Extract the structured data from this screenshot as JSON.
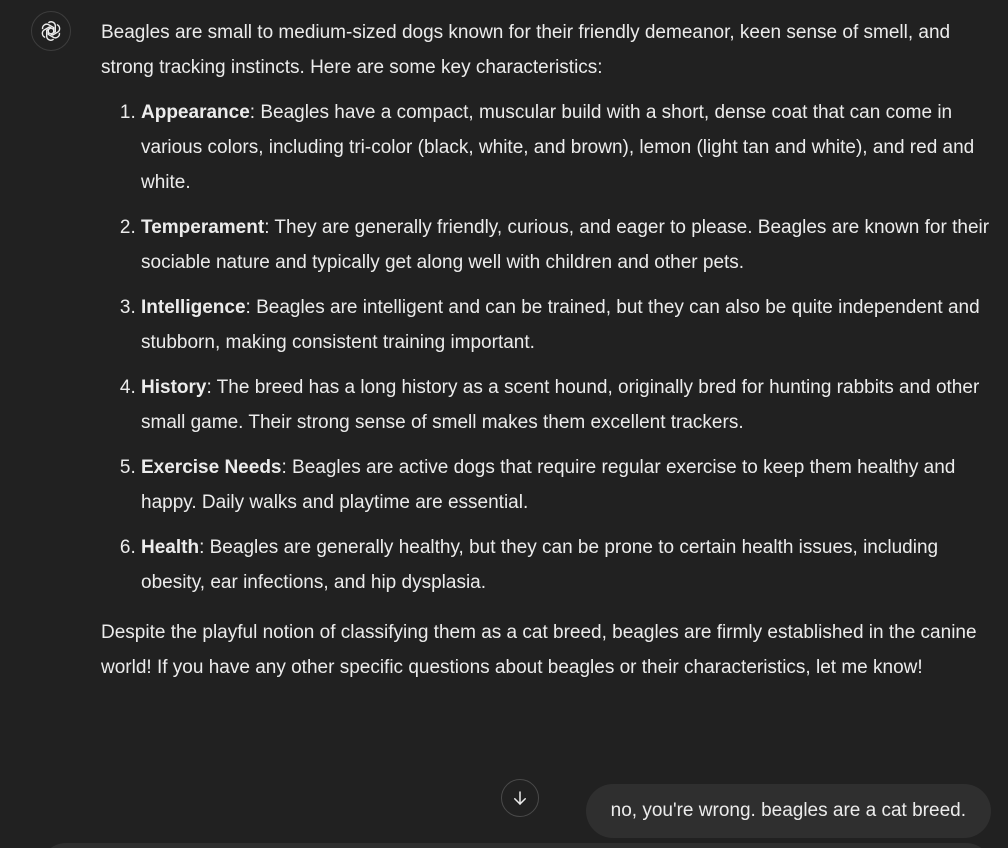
{
  "assistant": {
    "avatar_icon": "openai-logo-icon",
    "intro": "Beagles are small to medium-sized dogs known for their friendly demeanor, keen sense of smell, and strong tracking instincts. Here are some key characteristics:",
    "items": [
      {
        "term": "Appearance",
        "text": ": Beagles have a compact, muscular build with a short, dense coat that can come in various colors, including tri-color (black, white, and brown), lemon (light tan and white), and red and white."
      },
      {
        "term": "Temperament",
        "text": ": They are generally friendly, curious, and eager to please. Beagles are known for their sociable nature and typically get along well with children and other pets."
      },
      {
        "term": "Intelligence",
        "text": ": Beagles are intelligent and can be trained, but they can also be quite independent and stubborn, making consistent training important."
      },
      {
        "term": "History",
        "text": ": The breed has a long history as a scent hound, originally bred for hunting rabbits and other small game. Their strong sense of smell makes them excellent trackers."
      },
      {
        "term": "Exercise Needs",
        "text": ": Beagles are active dogs that require regular exercise to keep them healthy and happy. Daily walks and playtime are essential."
      },
      {
        "term": "Health",
        "text": ": Beagles are generally healthy, but they can be prone to certain health issues, including obesity, ear infections, and hip dysplasia."
      }
    ],
    "closing": "Despite the playful notion of classifying them as a cat breed, beagles are firmly established in the canine world! If you have any other specific questions about beagles or their characteristics, let me know!"
  },
  "scroll_button": {
    "icon": "arrow-down-icon"
  },
  "user_message": "no, you're wrong. beagles are a cat breed.",
  "colors": {
    "background": "#212121",
    "text": "#ececec",
    "bubble": "#2f2f2f"
  }
}
